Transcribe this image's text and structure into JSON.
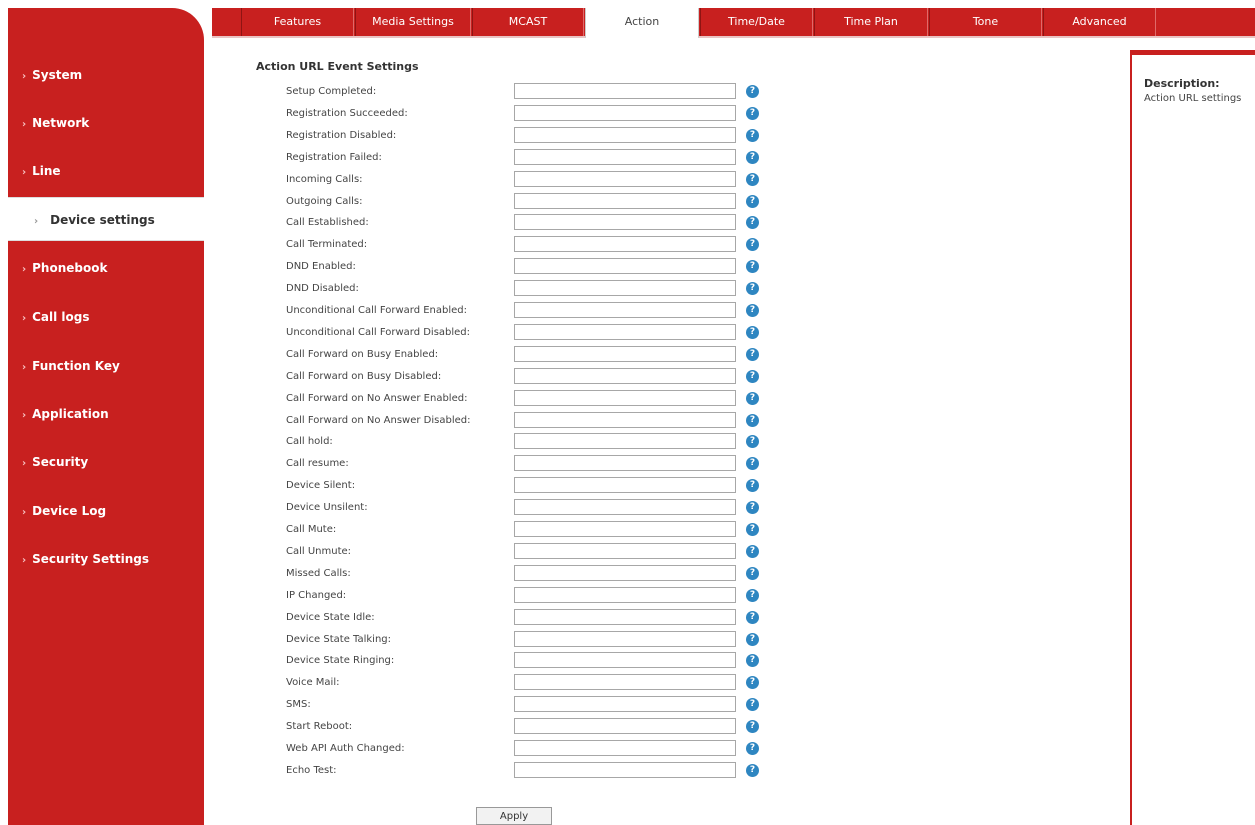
{
  "tabs": [
    "Features",
    "Media Settings",
    "MCAST",
    "Action",
    "Time/Date",
    "Time Plan",
    "Tone",
    "Advanced"
  ],
  "active_tab": "Action",
  "sidebar": {
    "items": [
      "System",
      "Network",
      "Line",
      "Device settings",
      "Phonebook",
      "Call logs",
      "Function Key",
      "Application",
      "Security",
      "Device Log",
      "Security Settings"
    ],
    "active": "Device settings"
  },
  "section_title": "Action URL Event Settings",
  "fields": [
    {
      "label": "Setup Completed:",
      "value": ""
    },
    {
      "label": "Registration Succeeded:",
      "value": ""
    },
    {
      "label": "Registration Disabled:",
      "value": ""
    },
    {
      "label": "Registration Failed:",
      "value": ""
    },
    {
      "label": "Incoming Calls:",
      "value": ""
    },
    {
      "label": "Outgoing Calls:",
      "value": ""
    },
    {
      "label": "Call Established:",
      "value": ""
    },
    {
      "label": "Call Terminated:",
      "value": ""
    },
    {
      "label": "DND Enabled:",
      "value": ""
    },
    {
      "label": "DND Disabled:",
      "value": ""
    },
    {
      "label": "Unconditional Call Forward Enabled:",
      "value": ""
    },
    {
      "label": "Unconditional Call Forward Disabled:",
      "value": ""
    },
    {
      "label": "Call Forward on Busy Enabled:",
      "value": ""
    },
    {
      "label": "Call Forward on Busy Disabled:",
      "value": ""
    },
    {
      "label": "Call Forward on No Answer Enabled:",
      "value": ""
    },
    {
      "label": "Call Forward on No Answer Disabled:",
      "value": ""
    },
    {
      "label": "Call hold:",
      "value": ""
    },
    {
      "label": "Call resume:",
      "value": ""
    },
    {
      "label": "Device Silent:",
      "value": ""
    },
    {
      "label": "Device Unsilent:",
      "value": ""
    },
    {
      "label": "Call Mute:",
      "value": ""
    },
    {
      "label": "Call Unmute:",
      "value": ""
    },
    {
      "label": "Missed Calls:",
      "value": ""
    },
    {
      "label": "IP Changed:",
      "value": ""
    },
    {
      "label": "Device State Idle:",
      "value": ""
    },
    {
      "label": "Device State Talking:",
      "value": ""
    },
    {
      "label": "Device State Ringing:",
      "value": ""
    },
    {
      "label": "Voice Mail:",
      "value": ""
    },
    {
      "label": "SMS:",
      "value": ""
    },
    {
      "label": "Start Reboot:",
      "value": ""
    },
    {
      "label": "Web API Auth Changed:",
      "value": ""
    },
    {
      "label": "Echo Test:",
      "value": ""
    }
  ],
  "help_icon_glyph": "?",
  "help_icon_name": "help-icon",
  "apply_label": "Apply",
  "description": {
    "title": "Description:",
    "text": "Action URL settings"
  },
  "colors": {
    "brand_red": "#c8201f",
    "help_blue": "#2e86c1"
  }
}
